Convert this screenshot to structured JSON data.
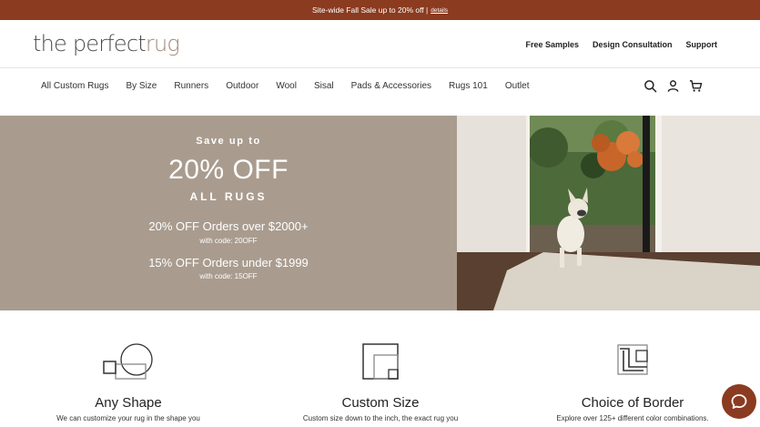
{
  "promo": {
    "text": "Site-wide Fall Sale up to 20% off |",
    "link": "details"
  },
  "header": {
    "logo_main": "the perfect",
    "logo_accent": "rug",
    "links": [
      "Free Samples",
      "Design Consultation",
      "Support"
    ]
  },
  "nav": {
    "items": [
      "All Custom Rugs",
      "By Size",
      "Runners",
      "Outdoor",
      "Wool",
      "Sisal",
      "Pads & Accessories",
      "Rugs 101",
      "Outlet"
    ],
    "icons": [
      "search-icon",
      "account-icon",
      "cart-icon"
    ]
  },
  "hero": {
    "save": "Save up to",
    "headline": "20% OFF",
    "subheadline": "ALL RUGS",
    "offer1": "20% OFF Orders over $2000+",
    "code1": "with code: 20OFF",
    "offer2": "15% OFF Orders under $1999",
    "code2": "with code: 15OFF"
  },
  "features": [
    {
      "title": "Any Shape",
      "desc": "We can customize your rug in the shape you",
      "icon": "shapes-icon"
    },
    {
      "title": "Custom Size",
      "desc": "Custom size down to the inch, the exact rug you",
      "icon": "custom-size-icon"
    },
    {
      "title": "Choice of Border",
      "desc": "Explore over 125+ different color combinations.",
      "icon": "border-icon"
    }
  ],
  "colors": {
    "promo_bg": "#8b3b1f",
    "hero_panel": "#a99c8f",
    "chat_button": "#8b3b1f"
  }
}
